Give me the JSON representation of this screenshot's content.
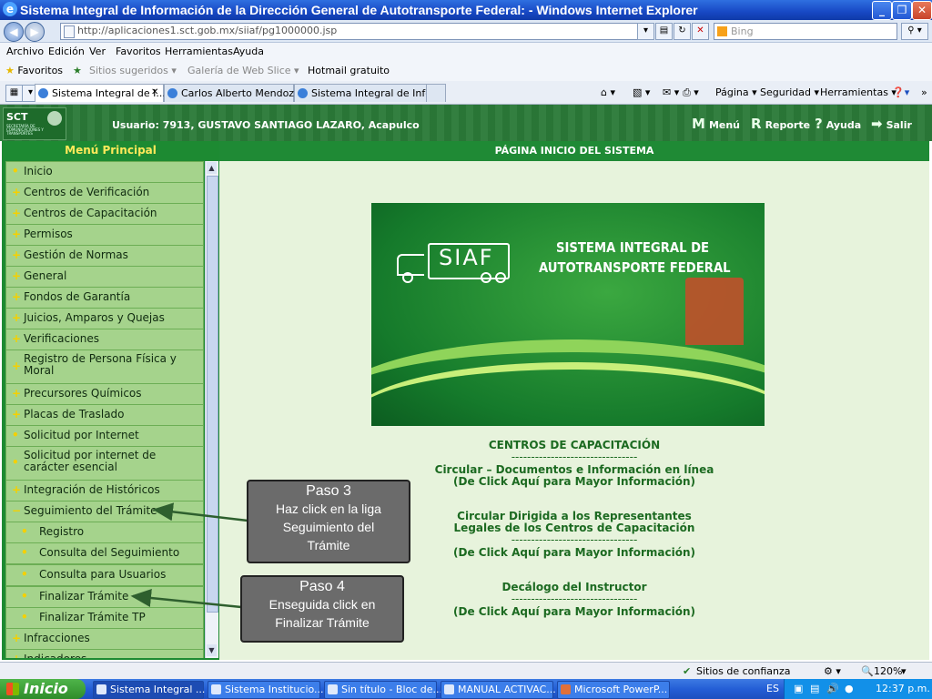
{
  "window": {
    "title": "Sistema Integral de Información de la Dirección General de Autotransporte Federal: - Windows Internet Explorer"
  },
  "address_bar": {
    "url": "http://aplicaciones1.sct.gob.mx/siiaf/pg1000000.jsp",
    "search_placeholder": "Bing"
  },
  "menu_bar": [
    "Archivo",
    "Edición",
    "Ver",
    "Favoritos",
    "Herramientas",
    "Ayuda"
  ],
  "favorites_bar": {
    "favorites_label": "Favoritos",
    "items": [
      "Sitios sugeridos ▾",
      "Galería de Web Slice ▾",
      "Hotmail gratuito"
    ]
  },
  "tabs": [
    {
      "label": "Sistema Integral de I..."
    },
    {
      "label": "Carlos Alberto Mendoza..."
    },
    {
      "label": "Sistema Integral de Info..."
    }
  ],
  "command_bar": [
    "Página ▾",
    "Seguridad ▾",
    "Herramientas ▾",
    "»"
  ],
  "app_header": {
    "logo": "SCT",
    "logo_sub": "SECRETARÍA DE COMUNICACIONES Y TRANSPORTES",
    "user": "Usuario: 7913, GUSTAVO SANTIAGO LAZARO, Acapulco",
    "links": [
      {
        "icon": "M",
        "label": "Menú"
      },
      {
        "icon": "R",
        "label": "Reporte"
      },
      {
        "icon": "?",
        "label": "Ayuda"
      },
      {
        "icon": "➡",
        "label": "Salir"
      }
    ]
  },
  "sidebar": {
    "title": "Menú Principal",
    "items": [
      {
        "bullet": "•",
        "label": "Inicio"
      },
      {
        "bullet": "+",
        "label": "Centros de Verificación"
      },
      {
        "bullet": "+",
        "label": "Centros de Capacitación"
      },
      {
        "bullet": "+",
        "label": "Permisos"
      },
      {
        "bullet": "+",
        "label": "Gestión de Normas"
      },
      {
        "bullet": "+",
        "label": "General"
      },
      {
        "bullet": "+",
        "label": "Fondos de Garantía"
      },
      {
        "bullet": "+",
        "label": "Juicios, Amparos y Quejas"
      },
      {
        "bullet": "+",
        "label": "Verificaciones"
      },
      {
        "bullet": "+",
        "label": "Registro de Persona Física y Moral"
      },
      {
        "bullet": "+",
        "label": "Precursores Químicos"
      },
      {
        "bullet": "+",
        "label": "Placas de Traslado"
      },
      {
        "bullet": "•",
        "label": "Solicitud por Internet"
      },
      {
        "bullet": "•",
        "label": "Solicitud por internet de carácter esencial"
      },
      {
        "bullet": "+",
        "label": "Integración de Históricos"
      },
      {
        "bullet": "−",
        "label": "Seguimiento del Trámite"
      },
      {
        "bullet": "•",
        "label": "Registro"
      },
      {
        "bullet": "•",
        "label": "Consulta del Seguimiento"
      },
      {
        "bullet": "•",
        "label": "Consulta para Usuarios"
      },
      {
        "bullet": "•",
        "label": "Finalizar Trámite"
      },
      {
        "bullet": "•",
        "label": "Finalizar Trámite TP"
      },
      {
        "bullet": "+",
        "label": "Infracciones"
      },
      {
        "bullet": "+",
        "label": "Indicadores"
      }
    ]
  },
  "main": {
    "header": "PÁGINA INICIO DEL SISTEMA",
    "banner": {
      "logo_text": "SIAF",
      "title_line1": "SISTEMA INTEGRAL DE",
      "title_line2": "AUTOTRANSPORTE FEDERAL"
    },
    "section_title": "CENTROS DE CAPACITACIÓN",
    "separator": "--------------------------------",
    "links": {
      "circular_docs": "Circular – Documentos e Información en línea",
      "click_info": "(De Click Aquí para Mayor Información)",
      "circular_rep_line1": "Circular Dirigida a los Representantes",
      "circular_rep_line2": "Legales de los Centros de Capacitación",
      "decalogo": "Decálogo del Instructor"
    }
  },
  "callouts": [
    {
      "title": "Paso 3",
      "line1": "Haz click en la liga",
      "line2": "Seguimiento del",
      "line3": "Trámite"
    },
    {
      "title": "Paso 4",
      "line1": "Enseguida click en",
      "line2": "Finalizar Trámite"
    }
  ],
  "status_bar": {
    "zone": "Sitios de confianza",
    "zoom": "120%"
  },
  "taskbar": {
    "start_label": "Inicio",
    "tasks": [
      "Sistema Integral ...",
      "Sistema Institucio...",
      "Sin título - Bloc de...",
      "MANUAL ACTIVAC...",
      "Microsoft PowerP..."
    ],
    "lang": "ES",
    "clock": "12:37 p.m."
  },
  "colors": {
    "app_green": "#1f8a35",
    "menu_item_green": "#a5d38c",
    "link_green": "#1c6a21",
    "callout_gray": "#6b6b6b"
  }
}
